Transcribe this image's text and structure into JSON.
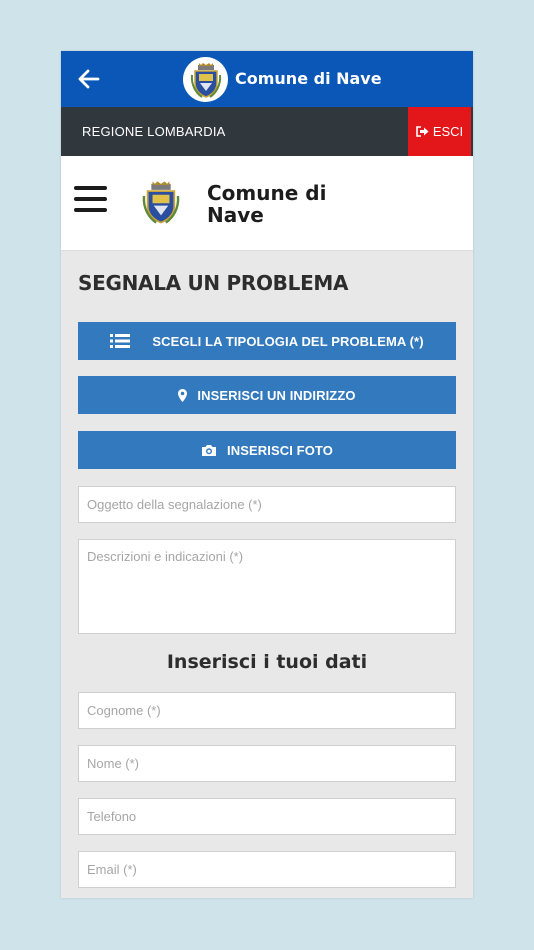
{
  "appbar": {
    "back_icon": "arrow-left-icon",
    "title": "Comune di Nave",
    "logo_icon": "crest-icon"
  },
  "region_bar": {
    "label": "REGIONE LOMBARDIA",
    "exit_label": "ESCI",
    "exit_icon": "sign-out-icon",
    "exit_color": "#e3171a"
  },
  "header": {
    "menu_icon": "hamburger-icon",
    "logo_icon": "crest-icon",
    "title": "Comune di Nave"
  },
  "page": {
    "title": "SEGNALA UN PROBLEMA"
  },
  "actions": [
    {
      "label": "SCEGLI LA TIPOLOGIA DEL PROBLEMA (*)",
      "icon": "list-icon"
    },
    {
      "label": "INSERISCI UN INDIRIZZO",
      "icon": "map-marker-icon"
    },
    {
      "label": "INSERISCI FOTO",
      "icon": "camera-icon"
    }
  ],
  "report_form": {
    "subject_placeholder": "Oggetto della segnalazione (*)",
    "description_placeholder": "Descrizioni e indicazioni (*)"
  },
  "personal_data": {
    "heading": "Inserisci i tuoi dati",
    "surname_placeholder": "Cognome (*)",
    "name_placeholder": "Nome (*)",
    "phone_placeholder": "Telefono",
    "email_placeholder": "Email (*)"
  },
  "colors": {
    "appbar": "#0a57b8",
    "region_bar": "#30373d",
    "button": "#3379bd",
    "background": "#cfe3ea"
  }
}
